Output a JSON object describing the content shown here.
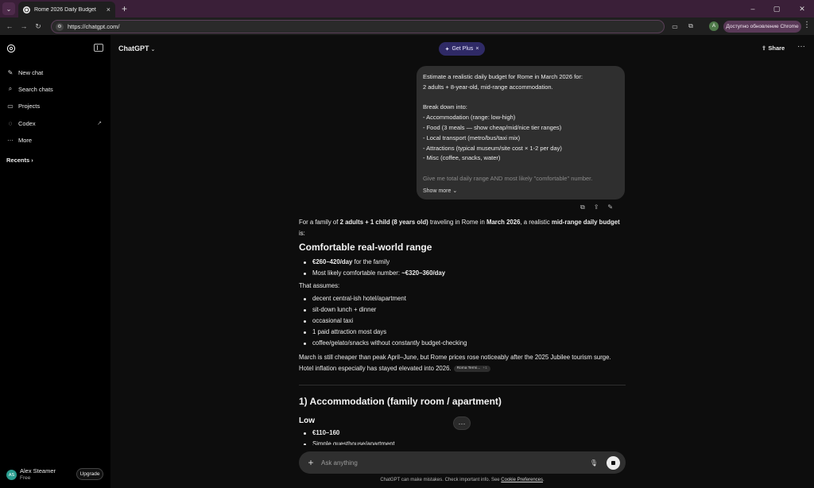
{
  "browser": {
    "tab_title": "Rome 2026 Daily Budget",
    "tab_close": "×",
    "new_tab": "+",
    "url": "https://chatgpt.com/",
    "profile_initial": "A",
    "update_label": "Доступно обновление Chrome",
    "window_controls": [
      "–",
      "▢",
      "✕"
    ]
  },
  "sidebar": {
    "items": [
      {
        "label": "New chat",
        "icon": "edit-icon"
      },
      {
        "label": "Search chats",
        "icon": "search-icon"
      },
      {
        "label": "Projects",
        "icon": "folder-icon"
      },
      {
        "label": "Codex",
        "icon": "codex-icon"
      },
      {
        "label": "More",
        "icon": "more-icon"
      }
    ],
    "recents_label": "Recents",
    "user": {
      "initials": "AS",
      "name": "Alex Steamer",
      "plan": "Free",
      "upgrade_label": "Upgrade"
    }
  },
  "header": {
    "model": "ChatGPT",
    "get_plus": "Get Plus",
    "share": "Share"
  },
  "user_message": {
    "lines": [
      "Estimate a realistic daily budget for Rome in March 2026 for:",
      "2 adults + 8-year-old, mid-range accommodation.",
      "",
      "Break down into:",
      "- Accommodation (range: low-high)",
      "- Food (3 meals — show cheap/mid/nice tier ranges)",
      "- Local transport (metro/bus/taxi mix)",
      "- Attractions (typical museum/site cost × 1-2 per day)",
      "- Misc (coffee, snacks, water)",
      "",
      "Give me total daily range AND most likely \"comfortable\" number."
    ],
    "show_more": "Show more"
  },
  "answer": {
    "intro": {
      "t1": "For a family of ",
      "b1": "2 adults + 1 child (8 years old)",
      "t2": " traveling in Rome in ",
      "b2": "March 2026",
      "t3": ", a realistic ",
      "b3": "mid-range daily budget",
      "t4": " is:"
    },
    "heading1": "Comfortable real-world range",
    "range_items": [
      {
        "bold": "€260–420/day",
        "rest": " for the family"
      },
      {
        "pre": "Most likely comfortable number: ",
        "bold": "~€320–360/day"
      }
    ],
    "assumes_label": "That assumes:",
    "assumes": [
      "decent central-ish hotel/apartment",
      "sit-down lunch + dinner",
      "occasional taxi",
      "1 paid attraction most days",
      "coffee/gelato/snacks without constantly budget-checking"
    ],
    "march_text": "March is still cheaper than peak April–June, but Rome prices rose noticeably after the 2025 Jubilee tourism surge. Hotel inflation especially has stayed elevated into 2026.",
    "citation": {
      "source": "Roma Termi...",
      "count": "+1"
    },
    "section1": "1) Accommodation (family room / apartment)",
    "low_label": "Low",
    "low_items": [
      "€110–160",
      "Simple guesthouse/apartment"
    ]
  },
  "composer": {
    "placeholder": "Ask anything"
  },
  "disclaimer": {
    "text": "ChatGPT can make mistakes. Check important info. See ",
    "link": "Cookie Preferences",
    "end": "."
  }
}
